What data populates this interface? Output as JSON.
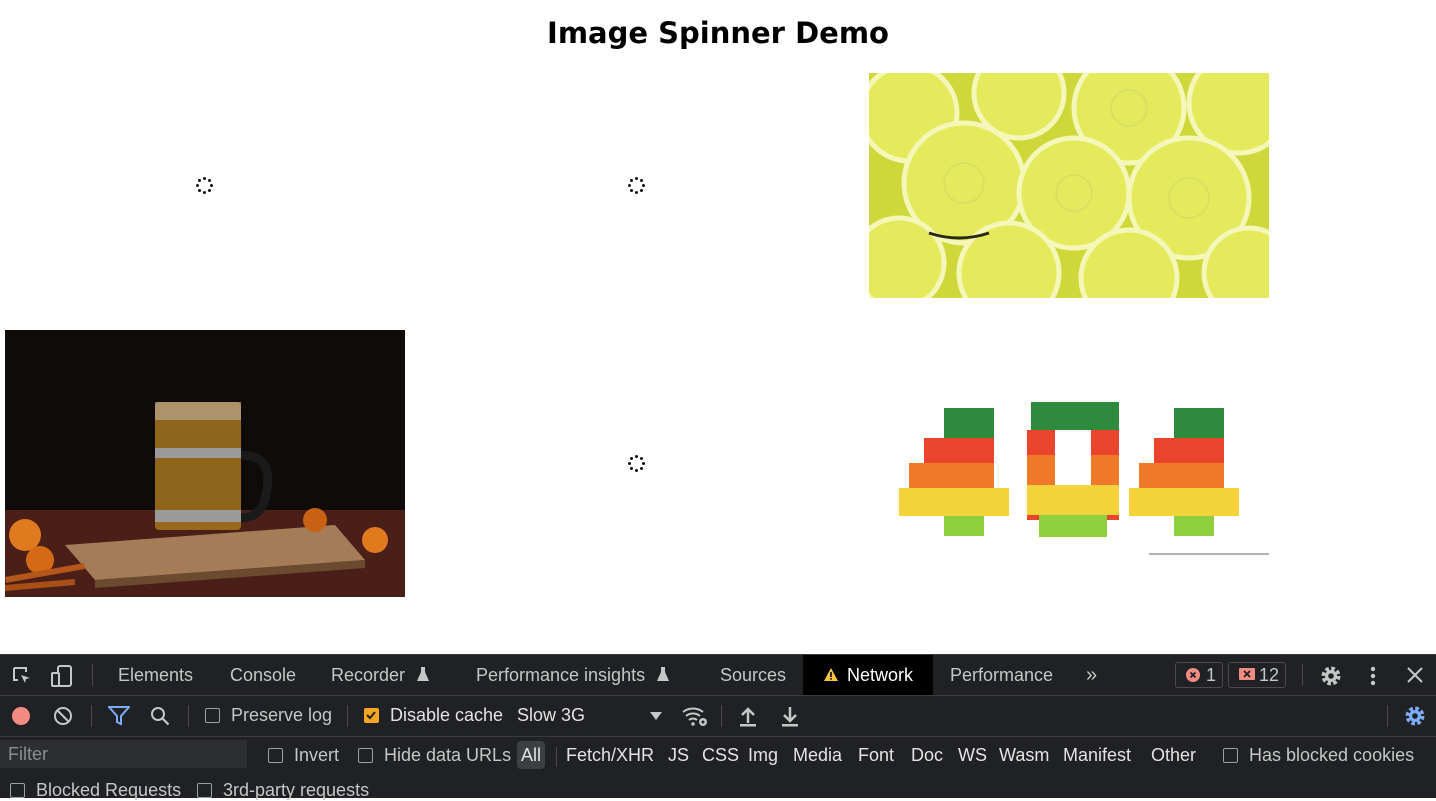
{
  "page": {
    "title": "Image Spinner Demo"
  },
  "devtools": {
    "tabs": [
      {
        "label": "Elements"
      },
      {
        "label": "Console"
      },
      {
        "label": "Recorder"
      },
      {
        "label": "Performance insights"
      },
      {
        "label": "Sources"
      },
      {
        "label": "Network"
      },
      {
        "label": "Performance"
      }
    ],
    "more_tabs": "»",
    "error_count": "1",
    "issue_count": "12",
    "toolbar": {
      "preserve_log": "Preserve log",
      "disable_cache": "Disable cache",
      "throttling": "Slow 3G"
    },
    "filter": {
      "placeholder": "Filter",
      "invert": "Invert",
      "hide_data_urls": "Hide data URLs",
      "types": [
        "All",
        "Fetch/XHR",
        "JS",
        "CSS",
        "Img",
        "Media",
        "Font",
        "Doc",
        "WS",
        "Wasm",
        "Manifest",
        "Other"
      ],
      "has_blocked_cookies": "Has blocked cookies",
      "blocked_requests": "Blocked Requests",
      "third_party": "3rd-party requests"
    }
  },
  "colors": {
    "devtools_bg": "#202124",
    "accent_blue": "#7cacf8",
    "checkbox_checked": "#f5a623",
    "record_red": "#f28b82"
  }
}
